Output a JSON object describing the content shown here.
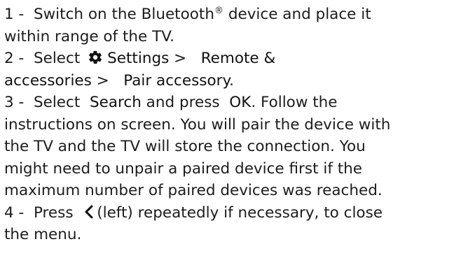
{
  "steps": [
    {
      "number": "1",
      "text_line1": "Switch on the Bluetooth",
      "reg_mark": "®",
      "text_line1_tail": " device and place it",
      "text_line2": "within range of the TV."
    },
    {
      "number": "2",
      "prefix": "Select",
      "icon": "gear-icon",
      "settings_label": "Settings",
      "sep1": ">",
      "remote_label": "Remote &",
      "remote_label2": "accessories",
      "sep2": ">",
      "pair_label": "Pair accessory",
      "end": "."
    },
    {
      "number": "3",
      "prefix": "Select",
      "search_label": "Search",
      "press": "and press",
      "ok_label": "OK",
      "line1_tail": ". Follow the",
      "line2": "instructions on screen. You will pair the device with",
      "line3": "the TV and the TV will store the connection. You",
      "line4": "might need to unpair a paired device first if the",
      "line5": "maximum number of paired devices was reached."
    },
    {
      "number": "4",
      "prefix": "Press",
      "icon": "chevron-left-icon",
      "line1_tail": "(left) repeatedly if necessary, to close",
      "line2": "the menu."
    }
  ]
}
